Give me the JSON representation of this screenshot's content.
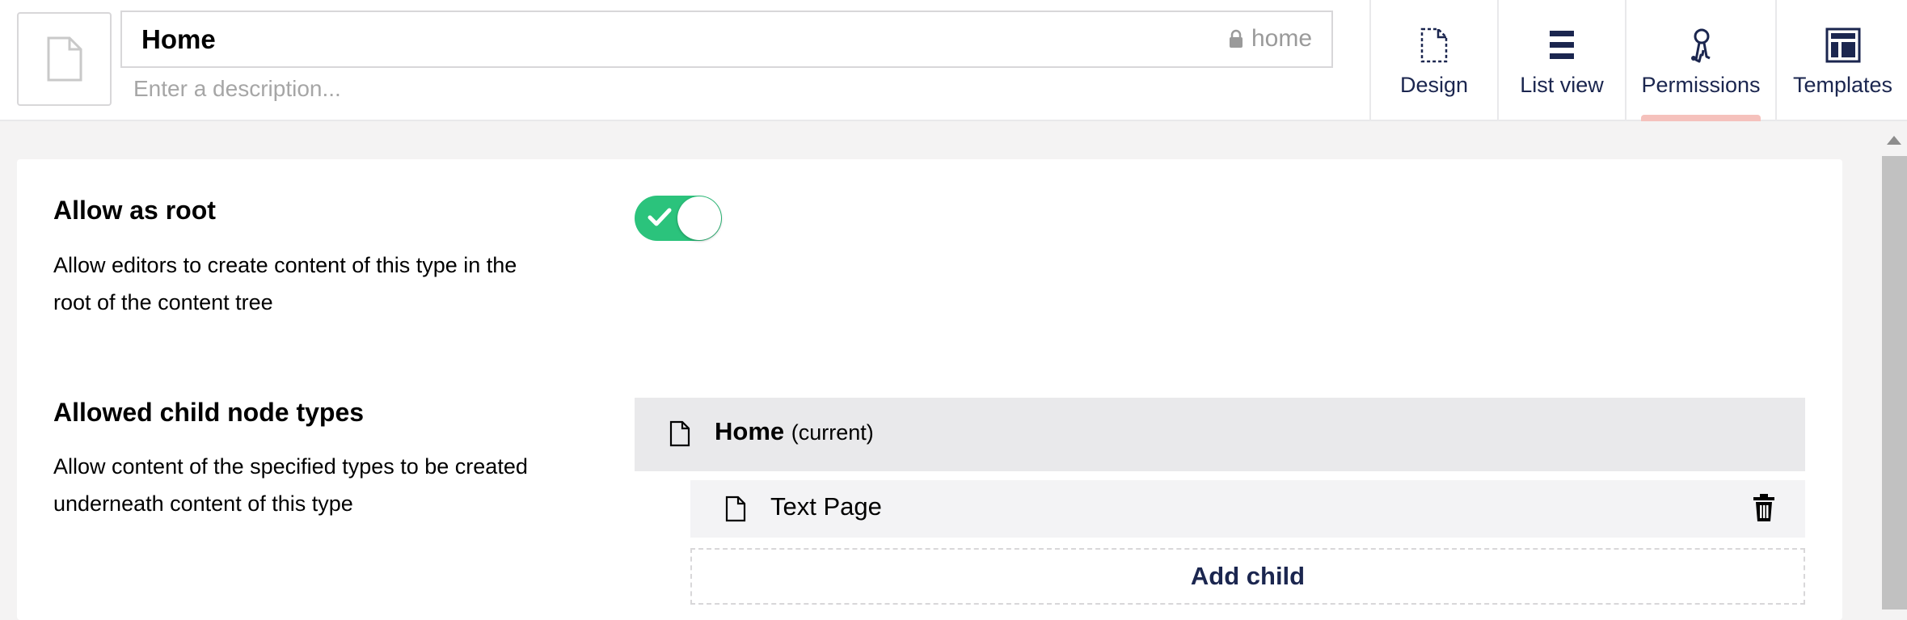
{
  "header": {
    "name_value": "Home",
    "alias": "home",
    "description_placeholder": "Enter a description..."
  },
  "tabs": [
    {
      "label": "Design",
      "icon": "document-dashed-icon",
      "active": false
    },
    {
      "label": "List view",
      "icon": "list-icon",
      "active": false
    },
    {
      "label": "Permissions",
      "icon": "keys-icon",
      "active": true
    },
    {
      "label": "Templates",
      "icon": "layout-icon",
      "active": false
    }
  ],
  "permissions": {
    "allow_root": {
      "title": "Allow as root",
      "description": "Allow editors to create content of this type in the root of the content tree",
      "enabled": true
    },
    "allowed_children": {
      "title": "Allowed child node types",
      "description": "Allow content of the specified types to be created underneath content of this type",
      "root_node": {
        "name": "Home",
        "suffix": "(current)"
      },
      "children": [
        {
          "name": "Text Page"
        }
      ],
      "add_label": "Add child"
    }
  },
  "colors": {
    "toggle_on": "#2bc37c",
    "active_tab_indicator": "#f5c1bc",
    "text_primary": "#1b264f"
  }
}
